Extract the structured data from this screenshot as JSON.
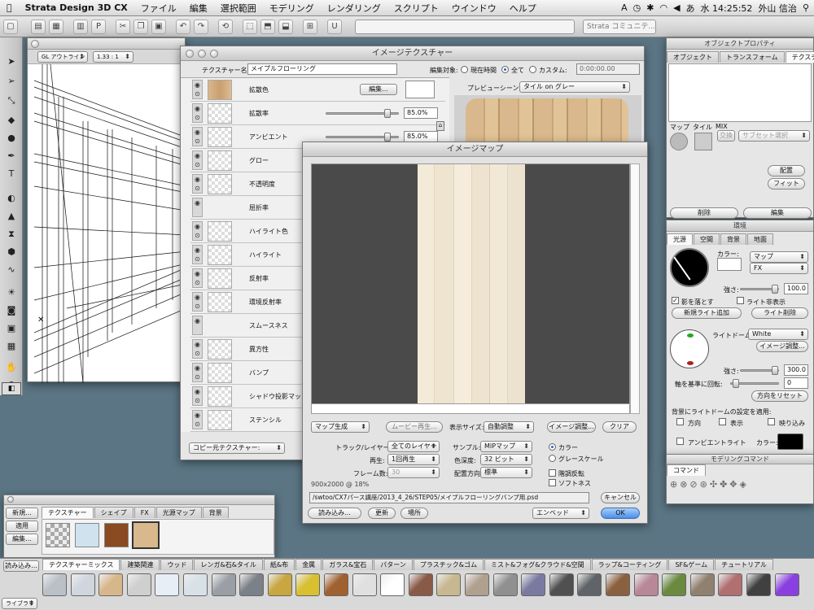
{
  "menubar": {
    "app": "Strata Design 3D CX",
    "items": [
      "ファイル",
      "編集",
      "選択範囲",
      "モデリング",
      "レンダリング",
      "スクリプト",
      "ウインドウ",
      "ヘルプ"
    ],
    "status": {
      "ime": "あ",
      "clock": "水 14:25:52",
      "user": "外山 信治"
    }
  },
  "toolbar": {
    "field_left": "",
    "field_right": "Strata コミュニテ..."
  },
  "viewport": {
    "title_field": "GL アウトライン",
    "zoom": "1.33 : 1"
  },
  "texture_window": {
    "title": "イメージテクスチャー",
    "name_label": "テクスチャー名:",
    "name_value": "メイプルフローリング",
    "edit_target_label": "編集対象:",
    "radio_current": "現在時間",
    "radio_all": "全て",
    "radio_custom": "カスタム:",
    "time_value": "0:00:00.00",
    "preview_label": "プレビューシーン:",
    "preview_value": "タイル on グレー",
    "rows": [
      {
        "label": "拡散色"
      },
      {
        "label": "拡散率",
        "value": "85.0%"
      },
      {
        "label": "アンビエント",
        "value": "85.0%"
      },
      {
        "label": "グロー"
      },
      {
        "label": "不透明度"
      },
      {
        "label": "屈折率"
      },
      {
        "label": "ハイライト色"
      },
      {
        "label": "ハイライト"
      },
      {
        "label": "反射率"
      },
      {
        "label": "環境反射率"
      },
      {
        "label": "スムースネス"
      },
      {
        "label": "異方性"
      },
      {
        "label": "バンプ"
      },
      {
        "label": "シャドウ投影マップ"
      },
      {
        "label": "ステンシル"
      }
    ],
    "edit_button": "編集...",
    "copy_source": "コピー元テクスチャー:",
    "diffuse_percent": 85,
    "ambient_percent": 85
  },
  "image_map": {
    "title": "イメージマップ",
    "map_generate": "マップ生成",
    "movie_play": "ムービー再生...",
    "display_size_label": "表示サイズ:",
    "display_size_value": "自動調整",
    "image_adjust": "イメージ調整...",
    "clear": "クリア",
    "track_label": "トラック/レイヤー:",
    "track_value": "全てのレイヤー",
    "sample_label": "サンプル:",
    "sample_value": "MIPマップ",
    "play_label": "再生:",
    "play_value": "1回再生",
    "depth_label": "色深度:",
    "depth_value": "32 ビット",
    "frames_label": "フレーム数:",
    "frames_value": "30",
    "orient_label": "配置方向:",
    "orient_value": "標準",
    "color": "カラー",
    "grayscale": "グレースケール",
    "invert": "階調反転",
    "soft": "ソフトネス",
    "dims": "900x2000 @ 18%",
    "path": "/swtoo/CX7パース講座/2013_4_26/STEP05/メイプルフローリングバンプ用.psd",
    "load": "読み込み...",
    "update": "更新",
    "location": "場所",
    "embed": "エンベッド",
    "cancel": "キャンセル",
    "ok": "OK"
  },
  "object_props": {
    "title": "オブジェクトプロパティ",
    "tabs": [
      "オブジェクト",
      "トランスフォーム",
      "テクスチャー"
    ],
    "subtabs": [
      "マップ",
      "タイル",
      "MIX"
    ],
    "swap": "交換",
    "subset": "サブセット選択",
    "place": "配置",
    "fit": "フィット",
    "delete": "削除",
    "edit": "編集"
  },
  "environment": {
    "title": "環境",
    "tabs": [
      "光源",
      "空間",
      "背景",
      "地面"
    ],
    "color_label": "カラー:",
    "map_value": "マップ",
    "fx_value": "FX",
    "strength_label": "強さ:",
    "strength_value": "100.0",
    "cast_shadow": "影を落とす",
    "hide_light": "ライト非表示",
    "add_light": "新規ライト追加",
    "delete_light": "ライト削除",
    "dome_label": "ライトドーム:",
    "dome_value": "White",
    "image_adjust": "イメージ調整...",
    "strength2_value": "300.0",
    "axis_label": "軸を基準に回転:",
    "axis_value": "0",
    "reset_dir": "方向をリセット",
    "apply_label": "背景にライトドームの設定を適用:",
    "opt_dir": "方向",
    "opt_show": "表示",
    "opt_mirror": "映り込み",
    "ambient_label": "アンビエントライト",
    "color2_label": "カラー:",
    "strength_percent": 95,
    "strength2_percent": 95,
    "axis_percent": 10
  },
  "modeling_cmd": {
    "title": "モデリングコマンド",
    "tab": "コマンド"
  },
  "resource_palette": {
    "tabs": [
      "テクスチャー",
      "シェイプ",
      "FX",
      "光源マップ",
      "背景"
    ],
    "new": "新規...",
    "apply": "適用",
    "edit": "編集..."
  },
  "library": {
    "read": "読み込み...",
    "tabs": [
      "テクスチャーミックス",
      "建築関連",
      "ウッド",
      "レンガ&石&タイル",
      "紙&布",
      "金属",
      "ガラス&宝石",
      "パターン",
      "プラスチック&ゴム",
      "ミスト&フォグ&クラウド&空間",
      "ラップ&コーティング",
      "SF&ゲーム",
      "チュートリアル"
    ],
    "dropdown": "ライブラリ",
    "tile_colors": [
      "#b9c0c8",
      "#cfd6de",
      "#d7b78a",
      "#cfcfcf",
      "#e6eef8",
      "#d8e0e8",
      "#9a9fa6",
      "#7c8088",
      "#c8a640",
      "#d8c030",
      "#a06030",
      "#e0e0e0",
      "#ffffff",
      "#8a5a48",
      "#c8b890",
      "#b0a090",
      "#909090",
      "#7a7aa0",
      "#505050",
      "#606468",
      "#8a6040",
      "#b88898",
      "#6a8a40",
      "#908070",
      "#b07070",
      "#404040",
      "#8a40e0"
    ]
  }
}
